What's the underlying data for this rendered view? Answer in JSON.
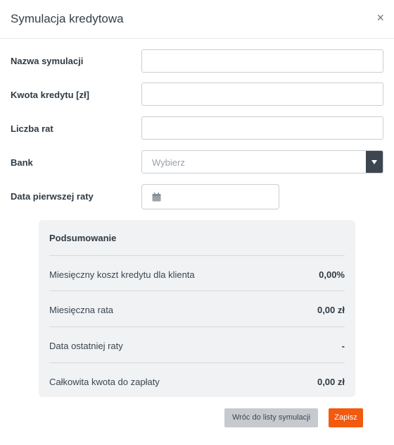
{
  "modal": {
    "title": "Symulacja kredytowa",
    "close_glyph": "×"
  },
  "form": {
    "name_label": "Nazwa symulacji",
    "name_value": "",
    "amount_label": "Kwota kredytu [zł]",
    "amount_value": "",
    "installments_label": "Liczba rat",
    "installments_value": "",
    "bank_label": "Bank",
    "bank_placeholder": "Wybierz",
    "first_date_label": "Data pierwszej raty",
    "first_date_value": ""
  },
  "summary": {
    "title": "Podsumowanie",
    "rows": [
      {
        "label": "Miesięczny koszt kredytu dla klienta",
        "value": "0,00%"
      },
      {
        "label": "Miesięczna rata",
        "value": "0,00 zł"
      },
      {
        "label": "Data ostatniej raty",
        "value": "-"
      },
      {
        "label": "Całkowita kwota do zapłaty",
        "value": "0,00 zł"
      }
    ]
  },
  "buttons": {
    "back_label": "Wróc do listy symulacji",
    "save_label": "Zapisz"
  },
  "icons": {
    "close": "close-icon",
    "calendar": "calendar-icon",
    "dropdown": "chevron-down-icon"
  },
  "colors": {
    "accent": "#f25a0f",
    "secondary_button": "#c6cacf",
    "summary_bg": "#f1f2f3",
    "select_arrow_bg": "#3d4650"
  }
}
